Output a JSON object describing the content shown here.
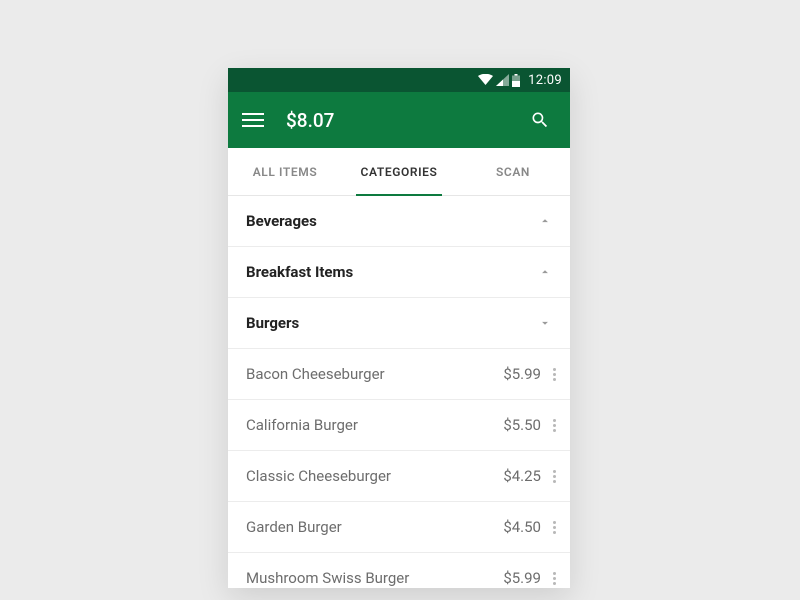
{
  "status": {
    "time": "12:09"
  },
  "appbar": {
    "total": "$8.07"
  },
  "tabs": {
    "all_items": "ALL ITEMS",
    "categories": "CATEGORIES",
    "scan": "SCAN"
  },
  "categories": [
    {
      "label": "Beverages",
      "expanded": false
    },
    {
      "label": "Breakfast Items",
      "expanded": false
    },
    {
      "label": "Burgers",
      "expanded": true
    }
  ],
  "items": [
    {
      "name": "Bacon Cheeseburger",
      "price": "$5.99"
    },
    {
      "name": "California Burger",
      "price": "$5.50"
    },
    {
      "name": "Classic Cheeseburger",
      "price": "$4.25"
    },
    {
      "name": "Garden Burger",
      "price": "$4.50"
    },
    {
      "name": "Mushroom Swiss Burger",
      "price": "$5.99"
    }
  ]
}
